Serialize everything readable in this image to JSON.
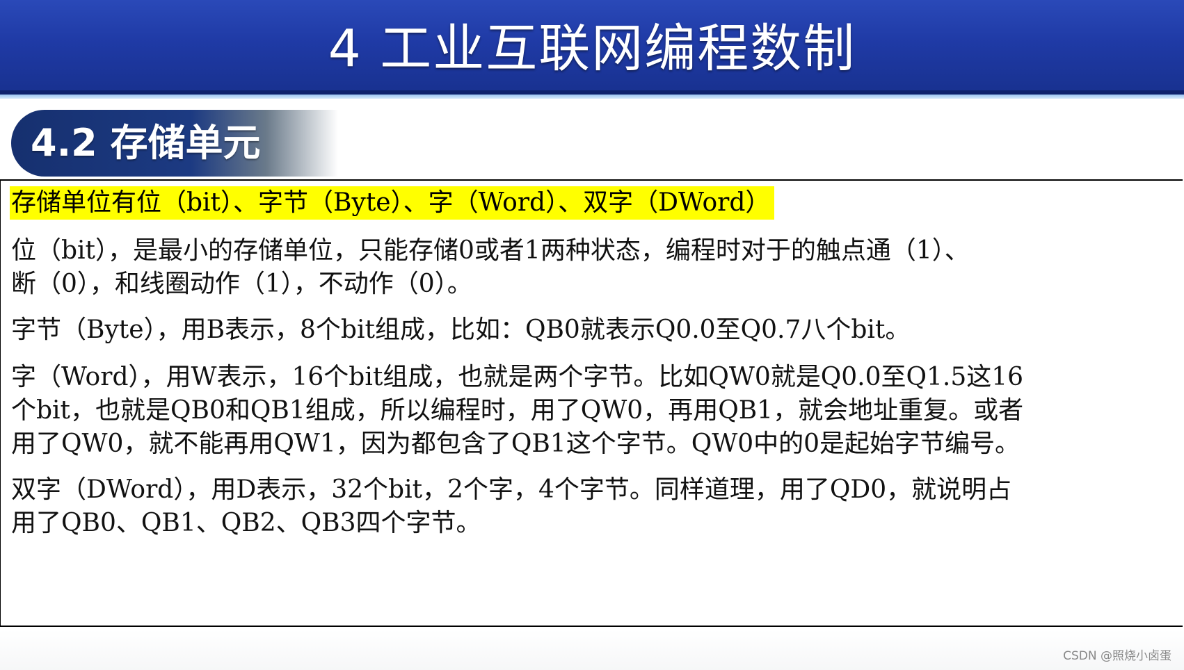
{
  "header": {
    "title": "4 工业互联网编程数制"
  },
  "section": {
    "title": "4.2 存储单元"
  },
  "content": {
    "highlight": "存储单位有位（bit）、字节（Byte）、字（Word）、双字（DWord）",
    "paragraphs": [
      {
        "line1": "位（bit），是最小的存储单位，只能存储0或者1两种状态，编程时对于的触点通（1）、",
        "line2": "断（0），和线圈动作（1），不动作（0）。"
      },
      {
        "line1": "字节（Byte），用B表示，8个bit组成，比如：QB0就表示Q0.0至Q0.7八个bit。"
      },
      {
        "line1": "字（Word），用W表示，16个bit组成，也就是两个字节。比如QW0就是Q0.0至Q1.5这16",
        "line2": "个bit，也就是QB0和QB1组成，所以编程时，用了QW0，再用QB1，就会地址重复。或者",
        "line3": "用了QW0，就不能再用QW1，因为都包含了QB1这个字节。QW0中的0是起始字节编号。"
      },
      {
        "line1": "双字（DWord），用D表示，32个bit，2个字，4个字节。同样道理，用了QD0，就说明占",
        "line2": "用了QB0、QB1、QB2、QB3四个字节。"
      }
    ]
  },
  "watermark": "CSDN @照烧小卤蛋",
  "colors": {
    "banner": "#1f3aa5",
    "pill": "#16306f",
    "highlight": "#ffff00"
  }
}
